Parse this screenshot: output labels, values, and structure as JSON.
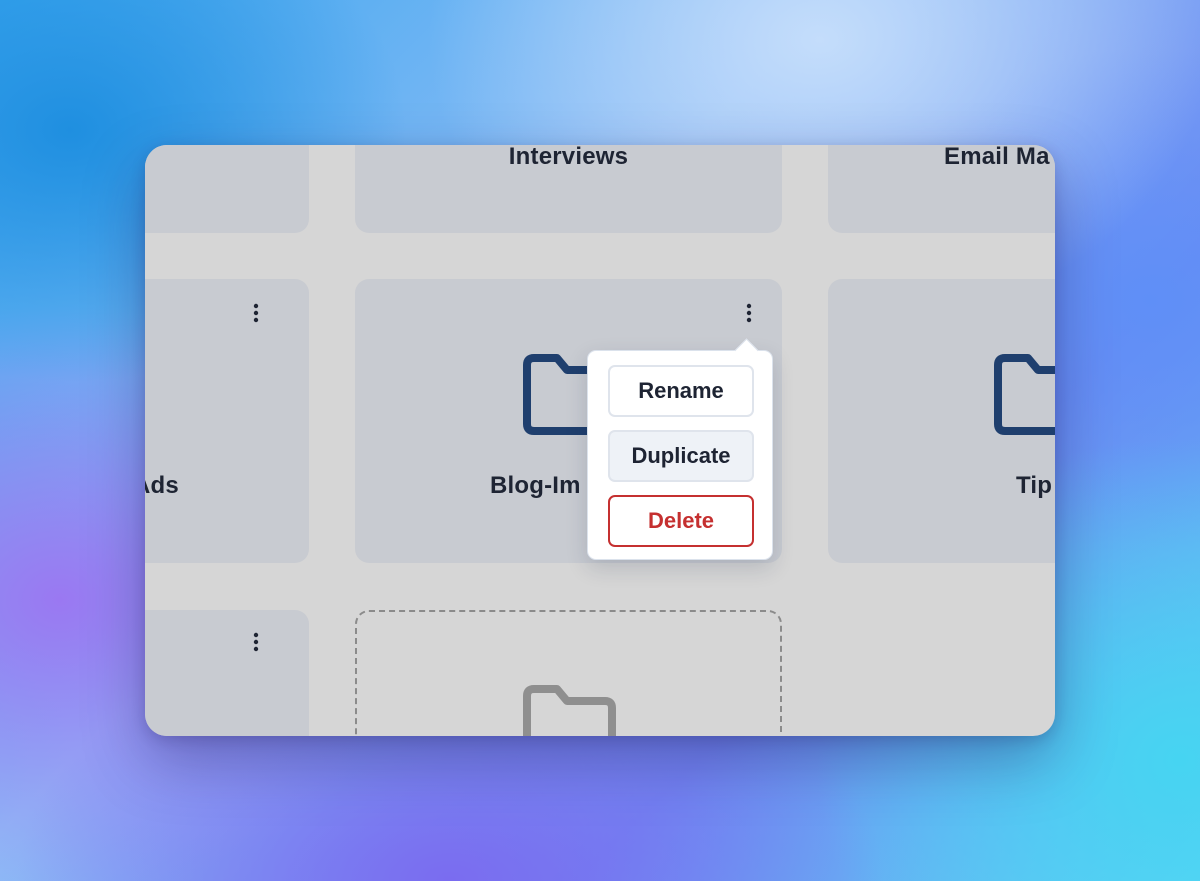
{
  "folders": [
    {
      "name": "Interviews"
    },
    {
      "name": "Email Ma"
    },
    {
      "name": "Ads"
    },
    {
      "name": "Blog-Im"
    },
    {
      "name": "Tip"
    }
  ],
  "context_menu": {
    "rename_label": "Rename",
    "duplicate_label": "Duplicate",
    "delete_label": "Delete"
  },
  "icons": {
    "folder": "folder-icon",
    "menu": "more-vertical-icon",
    "new_folder": "folder-outline-icon"
  },
  "colors": {
    "folder_icon": "#1f3f6e",
    "new_folder_icon": "#8f8f8f",
    "delete_accent": "#c53030",
    "card_bg": "#c8cbd1",
    "grid_bg": "#d6d6d6"
  }
}
